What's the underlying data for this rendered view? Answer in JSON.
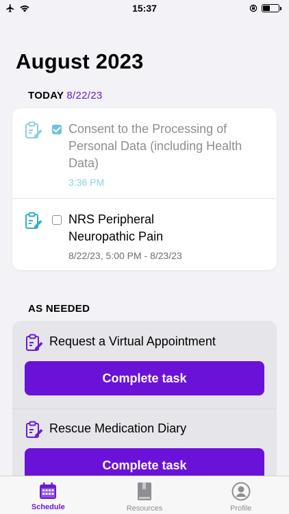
{
  "status": {
    "time": "15:37"
  },
  "header": {
    "month": "August 2023"
  },
  "today": {
    "label": "TODAY",
    "date": "8/22/23",
    "tasks": [
      {
        "title_l1": "Consent to the Processing of",
        "title_l2": "Personal Data (including Health",
        "title_l3": "Data)",
        "subtitle": "3:36 PM",
        "checked": true
      },
      {
        "title_l1": "NRS Peripheral",
        "title_l2": "Neuropathic Pain",
        "subtitle": "8/22/23, 5:00 PM - 8/23/23",
        "checked": false
      }
    ]
  },
  "as_needed": {
    "label": "AS NEEDED",
    "items": [
      {
        "title": "Request a Virtual Appointment",
        "button": "Complete task"
      },
      {
        "title": "Rescue Medication Diary",
        "button": "Complete task"
      }
    ]
  },
  "tabs": [
    {
      "label": "Schedule",
      "icon": "calendar-icon",
      "active": true
    },
    {
      "label": "Resources",
      "icon": "book-icon",
      "active": false
    },
    {
      "label": "Profile",
      "icon": "profile-icon",
      "active": false
    }
  ],
  "colors": {
    "accent": "#6a1ad6",
    "teal": "#4fb9c9",
    "button": "#6a12d8"
  }
}
